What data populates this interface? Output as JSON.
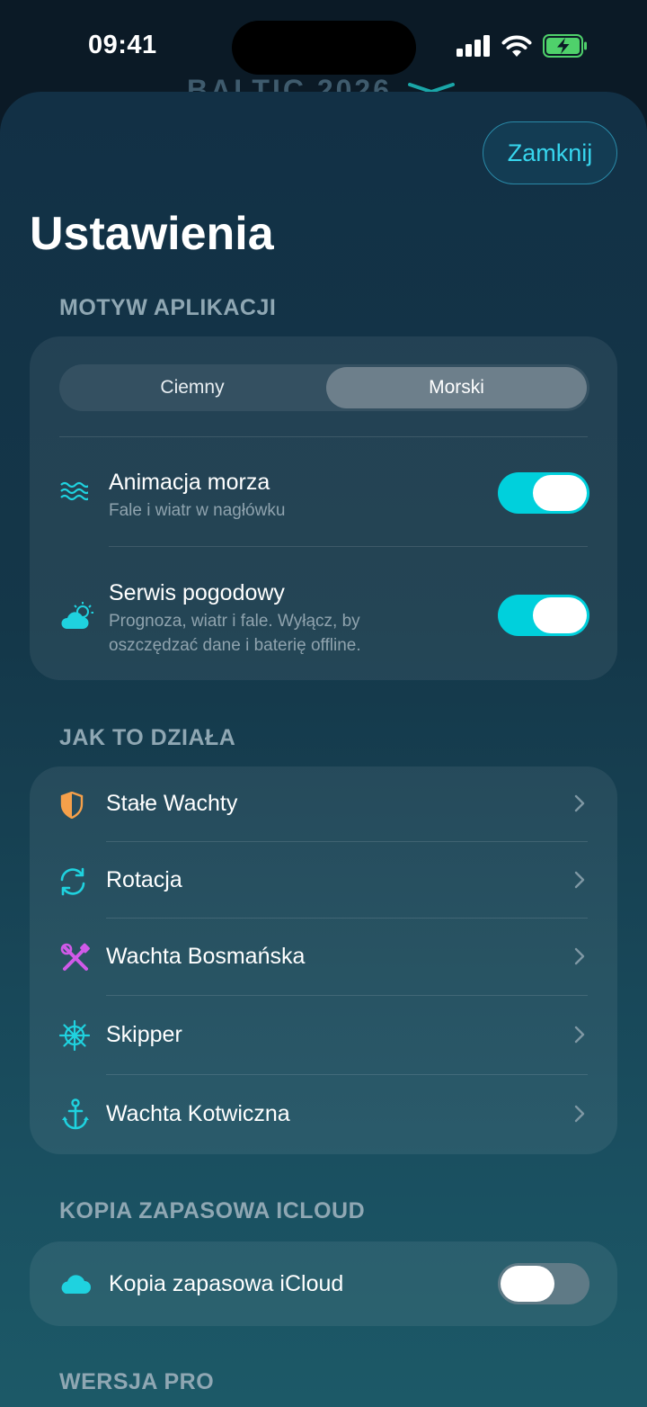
{
  "status_bar": {
    "time": "09:41"
  },
  "background_title": "BALTIC 2026",
  "sheet": {
    "close_label": "Zamknij",
    "title": "Ustawienia",
    "sections": {
      "theme": {
        "header": "MOTYW APLIKACJI",
        "segments": [
          "Ciemny",
          "Morski"
        ],
        "selected": "Morski",
        "rows": [
          {
            "title": "Animacja morza",
            "subtitle": "Fale i wiatr w nagłówku",
            "icon": "waves-icon",
            "toggle": true
          },
          {
            "title": "Serwis pogodowy",
            "subtitle_line1": "Prognoza, wiatr i fale. Wyłącz, by",
            "subtitle_line2": "oszczędzać dane i baterię offline.",
            "icon": "cloud-sun-icon",
            "toggle": true
          }
        ]
      },
      "how": {
        "header": "JAK TO DZIAŁA",
        "items": [
          {
            "label": "Stałe Wachty",
            "icon": "shield-icon"
          },
          {
            "label": "Rotacja",
            "icon": "rotate-icon"
          },
          {
            "label": "Wachta Bosmańska",
            "icon": "tools-icon"
          },
          {
            "label": "Skipper",
            "icon": "helm-icon"
          },
          {
            "label": "Wachta Kotwiczna",
            "icon": "anchor-icon"
          }
        ]
      },
      "backup": {
        "header": "KOPIA ZAPASOWA ICLOUD",
        "row": {
          "title": "Kopia zapasowa iCloud",
          "icon": "cloud-icon",
          "toggle": false
        }
      },
      "pro": {
        "header": "WERSJA PRO"
      }
    }
  },
  "colors": {
    "accent": "#00d0dc",
    "shield": "#f5a04a",
    "tools": "#d05ae8"
  }
}
